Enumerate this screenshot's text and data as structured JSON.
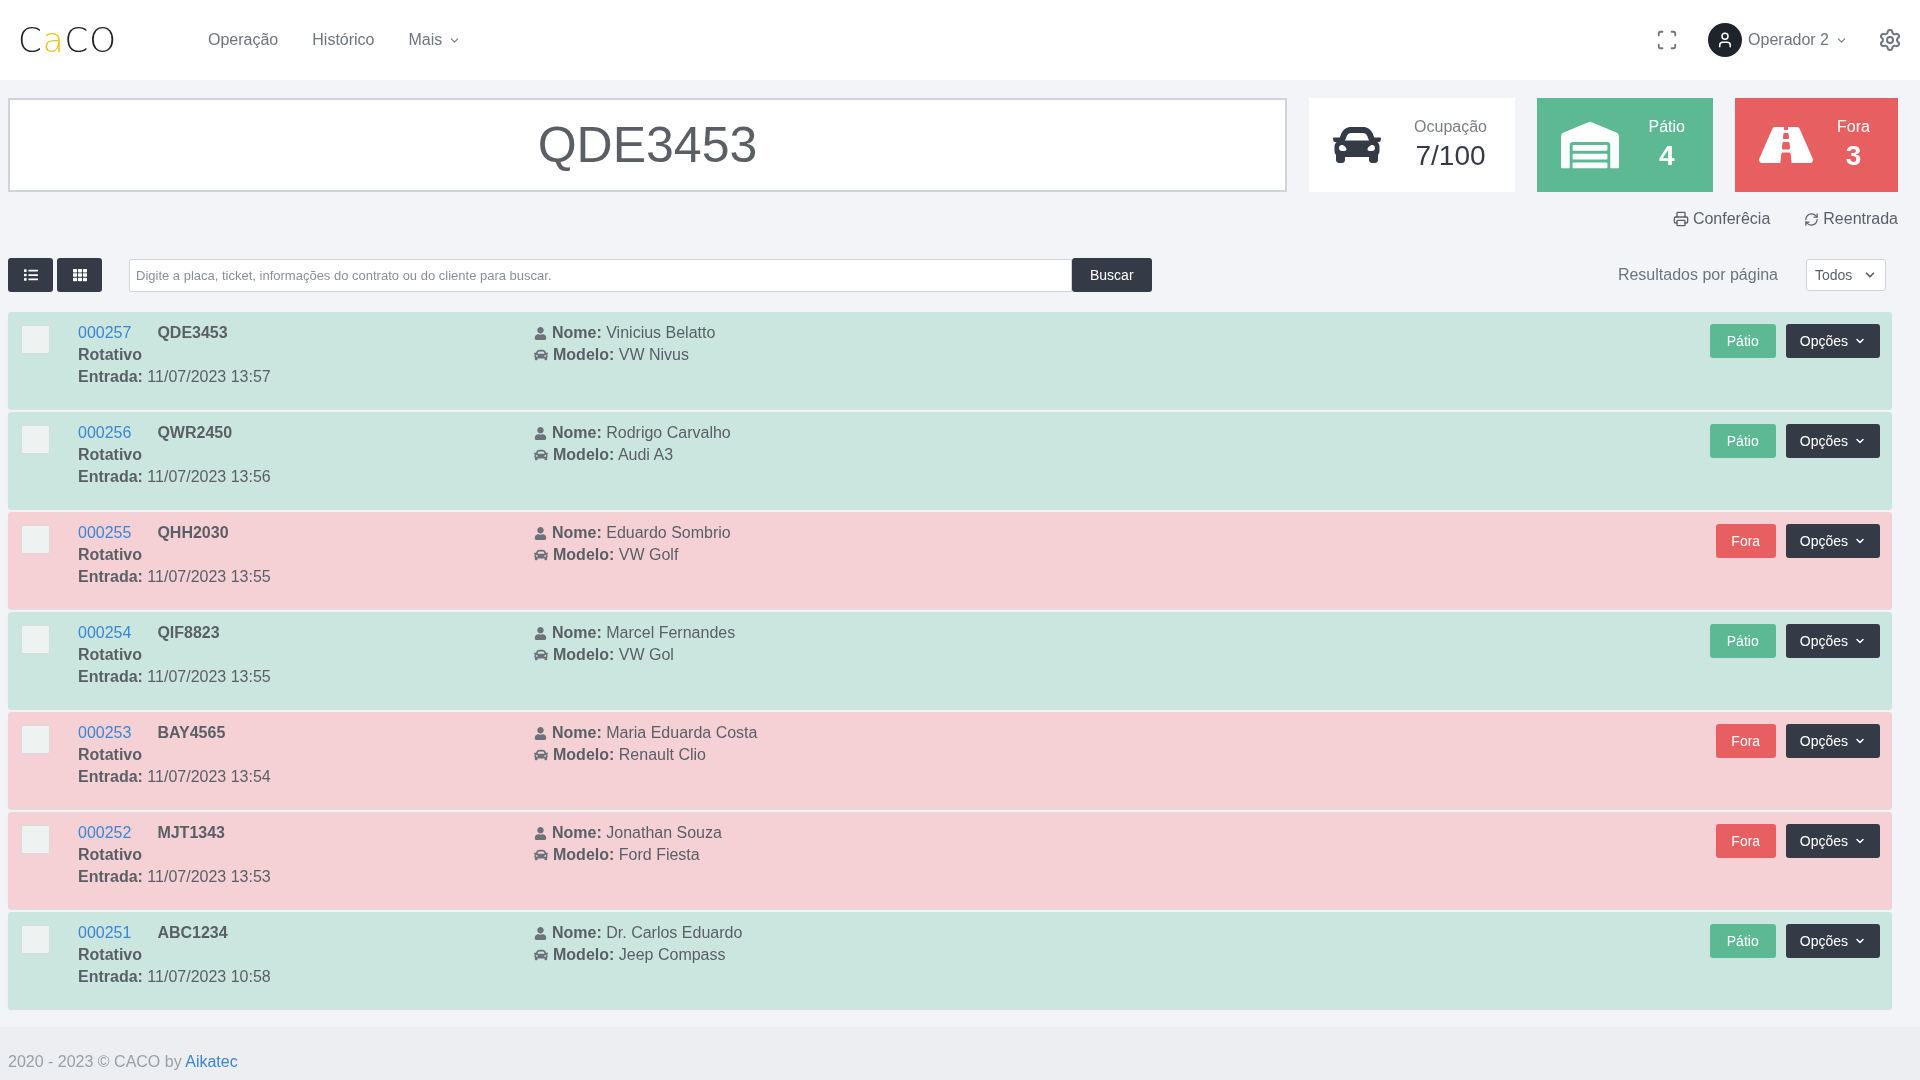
{
  "logo": {
    "parts": [
      {
        "text": "C",
        "accent": false
      },
      {
        "text": "a",
        "accent": true
      },
      {
        "text": "CO",
        "accent": false
      }
    ]
  },
  "nav": [
    {
      "label": "Operação",
      "dropdown": false
    },
    {
      "label": "Histórico",
      "dropdown": false
    },
    {
      "label": "Mais",
      "dropdown": true
    }
  ],
  "user": {
    "name": "Operador 2"
  },
  "plate_display": "QDE3453",
  "stats": [
    {
      "kind": "occupancy",
      "label": "Ocupação",
      "value": "7/100"
    },
    {
      "kind": "patio",
      "label": "Pátio",
      "value": "4"
    },
    {
      "kind": "fora",
      "label": "Fora",
      "value": "3"
    }
  ],
  "actions": [
    {
      "kind": "print",
      "label": "Conferêcia"
    },
    {
      "kind": "reentry",
      "label": "Reentrada"
    }
  ],
  "view_toggle": [
    {
      "kind": "list"
    },
    {
      "kind": "grid"
    }
  ],
  "search": {
    "placeholder": "Digite a placa, ticket, informações do contrato ou do cliente para buscar.",
    "button": "Buscar"
  },
  "per_page": {
    "label": "Resultados por página",
    "value": "Todos"
  },
  "rows": [
    {
      "ticket": "000257",
      "plate": "QDE3453",
      "type": "Rotativo",
      "entry_label": "Entrada:",
      "entry": "11/07/2023 13:57",
      "name_label": "Nome:",
      "name": "Vinicius Belatto",
      "model_label": "Modelo:",
      "model": "VW Nivus",
      "kind": "patio",
      "status_label": "Pátio",
      "options": "Opções",
      "checked": false
    },
    {
      "ticket": "000256",
      "plate": "QWR2450",
      "type": "Rotativo",
      "entry_label": "Entrada:",
      "entry": "11/07/2023 13:56",
      "name_label": "Nome:",
      "name": "Rodrigo Carvalho",
      "model_label": "Modelo:",
      "model": "Audi A3",
      "kind": "patio",
      "status_label": "Pátio",
      "options": "Opções",
      "checked": false
    },
    {
      "ticket": "000255",
      "plate": "QHH2030",
      "type": "Rotativo",
      "entry_label": "Entrada:",
      "entry": "11/07/2023 13:55",
      "name_label": "Nome:",
      "name": "Eduardo Sombrio",
      "model_label": "Modelo:",
      "model": "VW Golf",
      "kind": "fora",
      "status_label": "Fora",
      "options": "Opções",
      "checked": false
    },
    {
      "ticket": "000254",
      "plate": "QIF8823",
      "type": "Rotativo",
      "entry_label": "Entrada:",
      "entry": "11/07/2023 13:55",
      "name_label": "Nome:",
      "name": "Marcel Fernandes",
      "model_label": "Modelo:",
      "model": "VW Gol",
      "kind": "patio",
      "status_label": "Pátio",
      "options": "Opções",
      "checked": false
    },
    {
      "ticket": "000253",
      "plate": "BAY4565",
      "type": "Rotativo",
      "entry_label": "Entrada:",
      "entry": "11/07/2023 13:54",
      "name_label": "Nome:",
      "name": "Maria Eduarda Costa",
      "model_label": "Modelo:",
      "model": "Renault Clio",
      "kind": "fora",
      "status_label": "Fora",
      "options": "Opções",
      "checked": false
    },
    {
      "ticket": "000252",
      "plate": "MJT1343",
      "type": "Rotativo",
      "entry_label": "Entrada:",
      "entry": "11/07/2023 13:53",
      "name_label": "Nome:",
      "name": "Jonathan Souza",
      "model_label": "Modelo:",
      "model": "Ford Fiesta",
      "kind": "fora",
      "status_label": "Fora",
      "options": "Opções",
      "checked": false
    },
    {
      "ticket": "000251",
      "plate": "ABC1234",
      "type": "Rotativo",
      "entry_label": "Entrada:",
      "entry": "11/07/2023 10:58",
      "name_label": "Nome:",
      "name": "Dr. Carlos Eduardo",
      "model_label": "Modelo:",
      "model": "Jeep Compass",
      "kind": "patio",
      "status_label": "Pátio",
      "options": "Opções",
      "checked": false
    }
  ],
  "footer": {
    "text": "2020 - 2023 © CACO by",
    "link": "Aikatec"
  }
}
